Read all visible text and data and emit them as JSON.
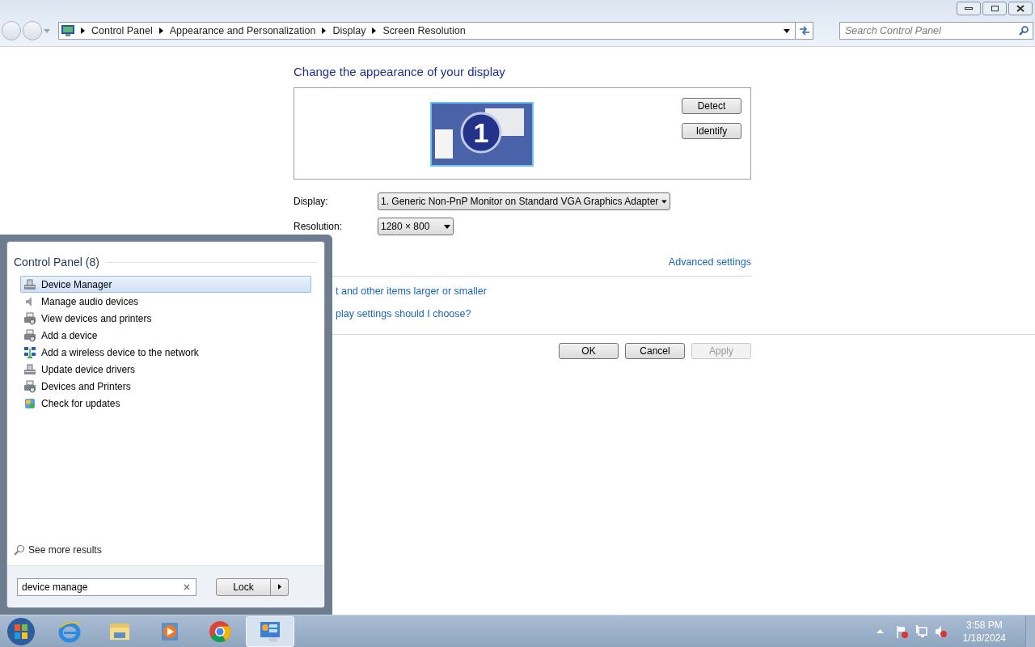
{
  "address_bar": {
    "breadcrumb": [
      "Control Panel",
      "Appearance and Personalization",
      "Display",
      "Screen Resolution"
    ],
    "search_placeholder": "Search Control Panel"
  },
  "content": {
    "heading": "Change the appearance of your display",
    "monitor_number": "1",
    "side_buttons": [
      "Detect",
      "Identify"
    ],
    "fields": [
      {
        "label": "Display:",
        "value": "1. Generic Non-PnP Monitor on Standard VGA Graphics Adapter",
        "kind": "wide"
      },
      {
        "label": "Resolution:",
        "value": "1280 × 800",
        "kind": "narrow"
      }
    ],
    "advanced_link": "Advanced settings",
    "links": [
      "t and other items larger or smaller",
      "play settings should I choose?"
    ],
    "dialog_buttons": [
      {
        "label": "OK",
        "disabled": false
      },
      {
        "label": "Cancel",
        "disabled": false
      },
      {
        "label": "Apply",
        "disabled": true
      }
    ]
  },
  "start_menu": {
    "group_heading": "Control Panel (8)",
    "results": [
      {
        "label": "Device Manager",
        "kind": "device",
        "selected": true
      },
      {
        "label": "Manage audio devices",
        "kind": "speaker",
        "selected": false
      },
      {
        "label": "View devices and printers",
        "kind": "printer",
        "selected": false
      },
      {
        "label": "Add a device",
        "kind": "printer",
        "selected": false
      },
      {
        "label": "Add a wireless device to the network",
        "kind": "network",
        "selected": false
      },
      {
        "label": "Update device drivers",
        "kind": "device",
        "selected": false
      },
      {
        "label": "Devices and Printers",
        "kind": "printer",
        "selected": false
      },
      {
        "label": "Check for updates",
        "kind": "updates",
        "selected": false
      }
    ],
    "see_more": "See more results",
    "search_value": "device manage",
    "power_button": "Lock"
  },
  "taskbar": {
    "apps": [
      {
        "kind": "browser-e",
        "active": false
      },
      {
        "kind": "folder",
        "active": false
      },
      {
        "kind": "media",
        "active": false
      },
      {
        "kind": "chrome",
        "active": false
      },
      {
        "kind": "control-panel",
        "active": true
      }
    ],
    "time": "3:58 PM",
    "date": "1/18/2024"
  }
}
